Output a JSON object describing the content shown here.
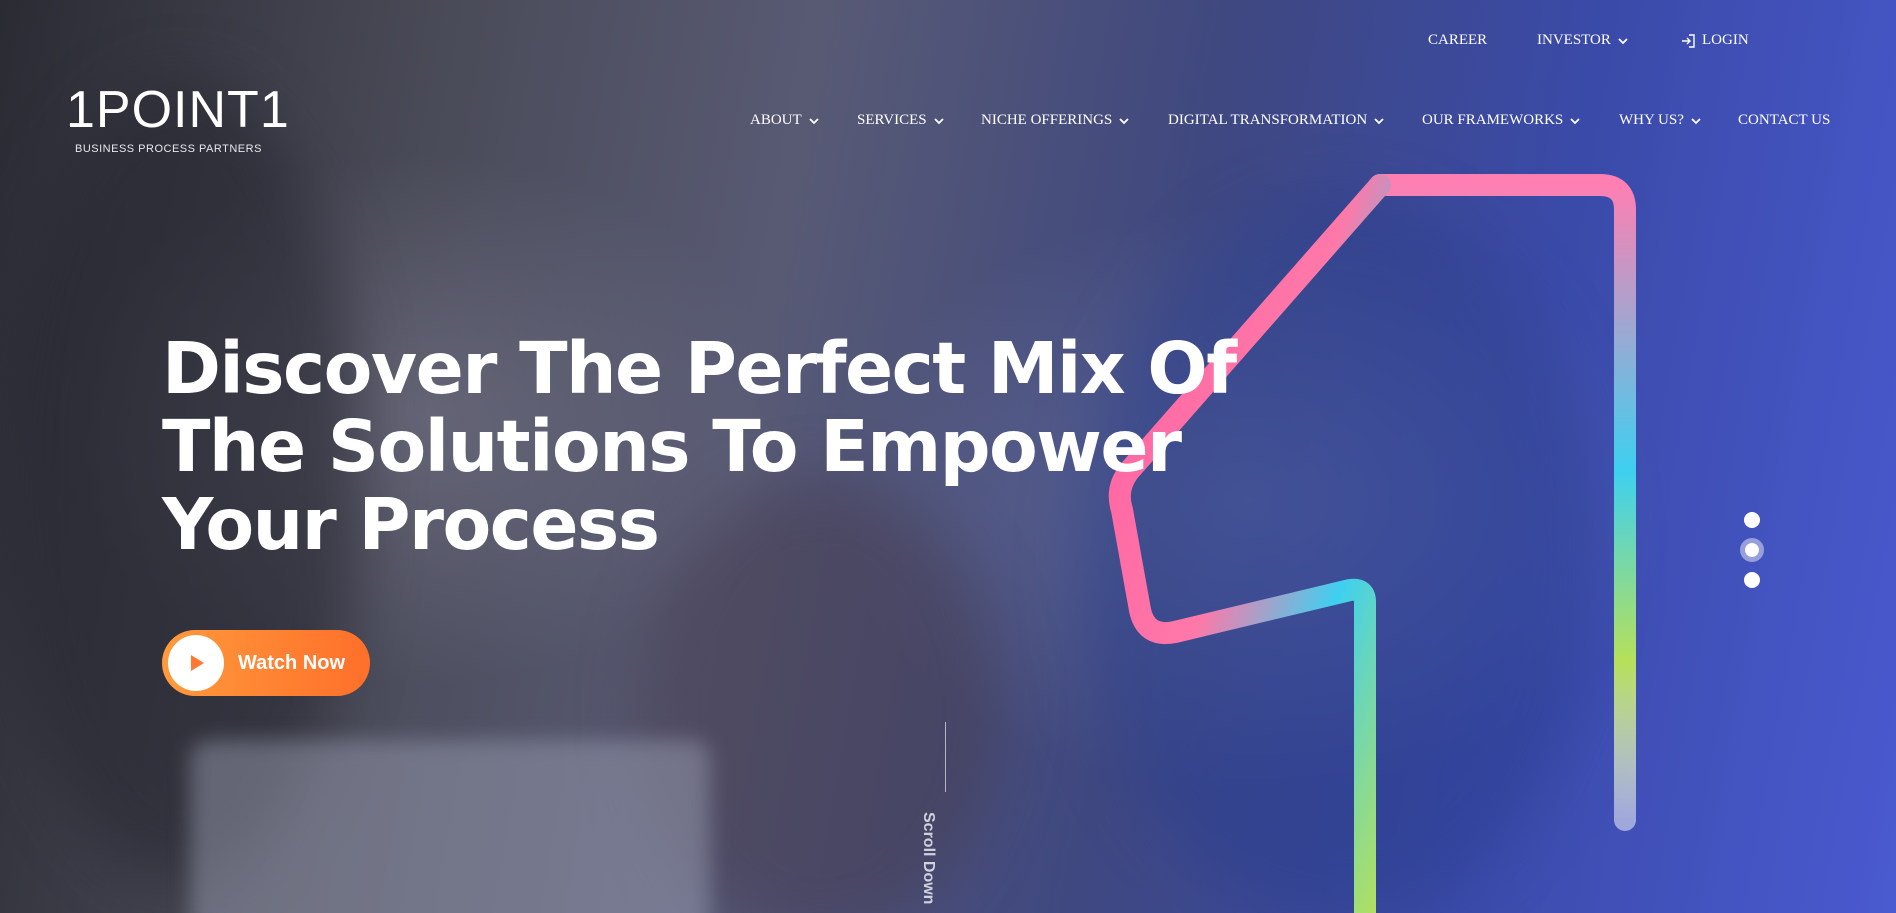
{
  "topbar": {
    "career": "CAREER",
    "investor": "INVESTOR",
    "login": "LOGIN"
  },
  "logo": {
    "name": "1POINT1",
    "tagline": "BUSINESS PROCESS PARTNERS"
  },
  "nav": {
    "items": [
      {
        "label": "ABOUT"
      },
      {
        "label": "SERVICES"
      },
      {
        "label": "NICHE OFFERINGS"
      },
      {
        "label": "DIGITAL TRANSFORMATION"
      },
      {
        "label": "OUR FRAMEWORKS"
      },
      {
        "label": "WHY US?"
      },
      {
        "label": "CONTACT US"
      }
    ]
  },
  "hero": {
    "headline_lines": [
      "Discover The Perfect Mix Of",
      "The Solutions To Empower",
      "Your Process"
    ],
    "cta_label": "Watch Now",
    "scroll_label": "Scroll Down",
    "slide_count": 3,
    "active_slide": 2
  },
  "colors": {
    "cta_start": "#ff9a3c",
    "cta_end": "#ff6f2a",
    "shape_pink": "#ff5fa2",
    "shape_cyan": "#3ed0f0",
    "shape_green": "#b6e05a"
  }
}
